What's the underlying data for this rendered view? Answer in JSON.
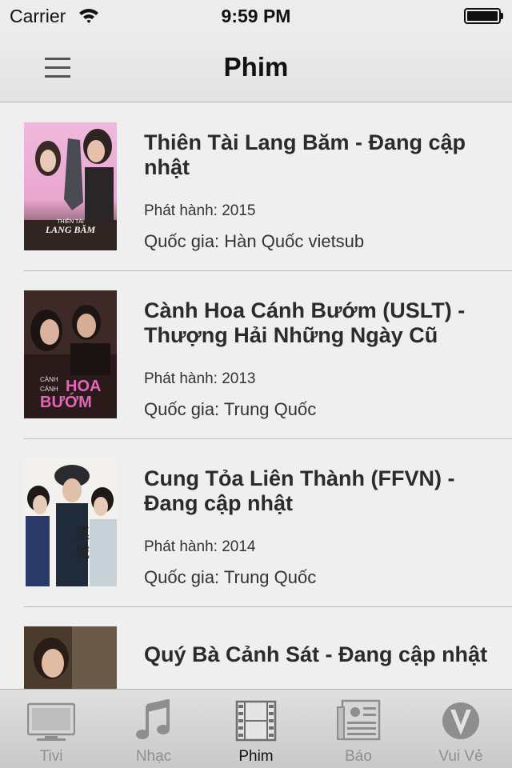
{
  "status_bar": {
    "carrier": "Carrier",
    "time": "9:59 PM"
  },
  "nav": {
    "title": "Phim"
  },
  "movies": [
    {
      "title": "Thiên Tài Lang Băm - Đang cập nhật",
      "release": "Phát hành: 2015",
      "country": "Quốc gia: Hàn Quốc vietsub",
      "poster_text": "THIÊN TÀI LANG BĂM"
    },
    {
      "title": "Cành Hoa Cánh Bướm (USLT) - Thượng Hải Những Ngày Cũ",
      "release": "Phát hành: 2013",
      "country": "Quốc gia: Trung Quốc",
      "poster_text": "CÁNH HOA BƯỚM"
    },
    {
      "title": "Cung Tỏa Liên Thành (FFVN) - Đang cập nhật",
      "release": "Phát hành: 2014",
      "country": "Quốc gia: Trung Quốc"
    },
    {
      "title": "Quý Bà Cảnh Sát - Đang cập nhật",
      "release": "",
      "country": ""
    }
  ],
  "tabs": [
    {
      "label": "Tivi",
      "icon": "tv-icon"
    },
    {
      "label": "Nhạc",
      "icon": "music-note-icon"
    },
    {
      "label": "Phim",
      "icon": "film-strip-icon"
    },
    {
      "label": "Báo",
      "icon": "newspaper-icon"
    },
    {
      "label": "Vui Vẻ",
      "icon": "v-logo-icon"
    }
  ],
  "active_tab": "Phim",
  "colors": {
    "background": "#efefef",
    "active_tab_label": "#111111",
    "inactive_tab_label": "#8f8f8f"
  }
}
